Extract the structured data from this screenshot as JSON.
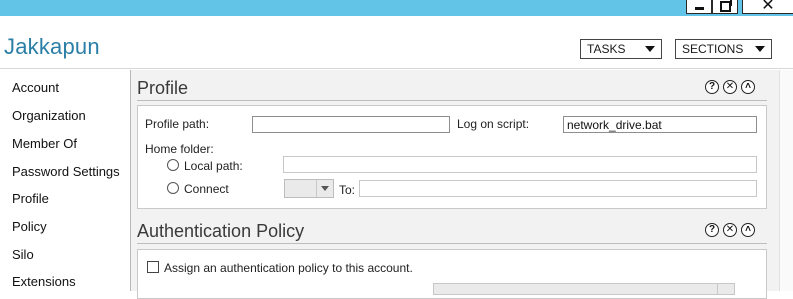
{
  "window": {
    "minimize_glyph": "",
    "maximize_glyph": "",
    "close_glyph": "✕"
  },
  "header": {
    "title": "Jakkapun",
    "tasks_label": "TASKS",
    "sections_label": "SECTIONS"
  },
  "nav": {
    "items": [
      {
        "label": "Account"
      },
      {
        "label": "Organization"
      },
      {
        "label": "Member Of"
      },
      {
        "label": "Password Settings"
      },
      {
        "label": "Profile"
      },
      {
        "label": "Policy"
      },
      {
        "label": "Silo"
      },
      {
        "label": "Extensions"
      }
    ]
  },
  "profile": {
    "title": "Profile",
    "help_glyph": "?",
    "close_glyph": "✕",
    "collapse_glyph": "˄",
    "profile_path_label": "Profile path:",
    "profile_path_value": "",
    "logon_script_label": "Log on script:",
    "logon_script_value": "network_drive.bat",
    "home_folder_label": "Home folder:",
    "local_path_label": "Local path:",
    "local_path_value": "",
    "connect_label": "Connect",
    "drive_value": "",
    "to_label": "To:",
    "to_value": ""
  },
  "auth_policy": {
    "title": "Authentication Policy",
    "help_glyph": "?",
    "close_glyph": "✕",
    "collapse_glyph": "˄",
    "assign_label": "Assign an authentication policy to this account."
  }
}
